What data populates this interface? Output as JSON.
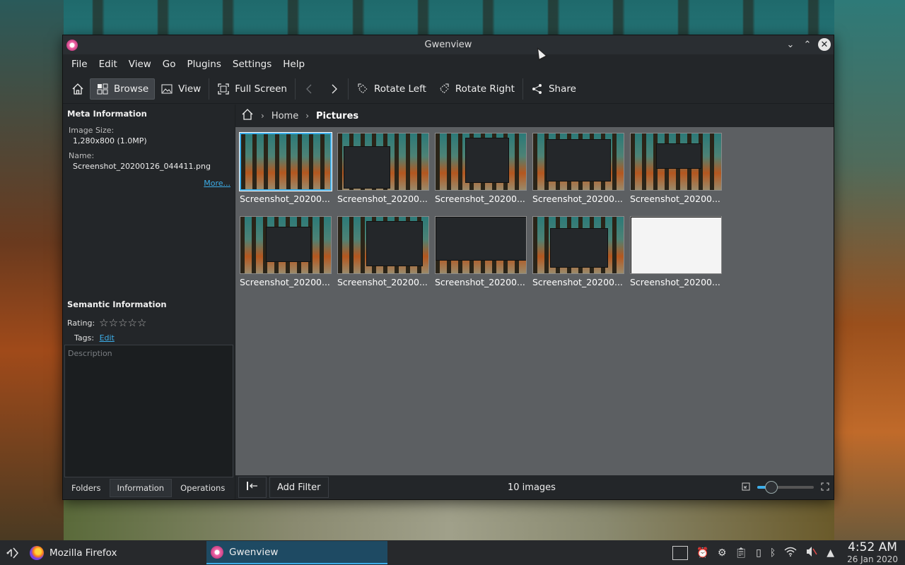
{
  "window": {
    "title": "Gwenview",
    "controls": [
      "minimize",
      "maximize",
      "close"
    ]
  },
  "menubar": [
    "File",
    "Edit",
    "View",
    "Go",
    "Plugins",
    "Settings",
    "Help"
  ],
  "toolbar": {
    "browse": "Browse",
    "view": "View",
    "fullscreen": "Full Screen",
    "rotate_left": "Rotate Left",
    "rotate_right": "Rotate Right",
    "share": "Share"
  },
  "sidebar": {
    "meta_title": "Meta Information",
    "image_size_label": "Image Size:",
    "image_size_value": "1,280x800 (1.0MP)",
    "name_label": "Name:",
    "name_value": "Screenshot_20200126_044411.png",
    "more_link": "More...",
    "semantic_title": "Semantic Information",
    "rating_label": "Rating:",
    "rating_value": 0,
    "rating_stars": "☆☆☆☆☆",
    "tags_label": "Tags:",
    "tags_edit": "Edit",
    "description_placeholder": "Description",
    "tabs": [
      "Folders",
      "Information",
      "Operations"
    ],
    "active_tab": "Information"
  },
  "breadcrumb": {
    "home": "Home",
    "current": "Pictures"
  },
  "thumbnails": [
    {
      "label": "Screenshot_20200..."
    },
    {
      "label": "Screenshot_20200..."
    },
    {
      "label": "Screenshot_20200..."
    },
    {
      "label": "Screenshot_20200..."
    },
    {
      "label": "Screenshot_20200..."
    },
    {
      "label": "Screenshot_20200..."
    },
    {
      "label": "Screenshot_20200..."
    },
    {
      "label": "Screenshot_20200..."
    },
    {
      "label": "Screenshot_20200..."
    },
    {
      "label": "Screenshot_20200..."
    }
  ],
  "statusbar": {
    "add_filter": "Add Filter",
    "count": "10 images",
    "zoom_level": 0.25
  },
  "taskbar": {
    "tasks": [
      {
        "label": "Mozilla Firefox",
        "icon": "firefox-icon"
      },
      {
        "label": "Gwenview",
        "icon": "gwenview-icon"
      }
    ],
    "time": "4:52 AM",
    "date": "26 Jan 2020"
  },
  "colors": {
    "accent": "#3daee9",
    "window_bg": "#232629",
    "grid_bg": "#5c5f62"
  }
}
